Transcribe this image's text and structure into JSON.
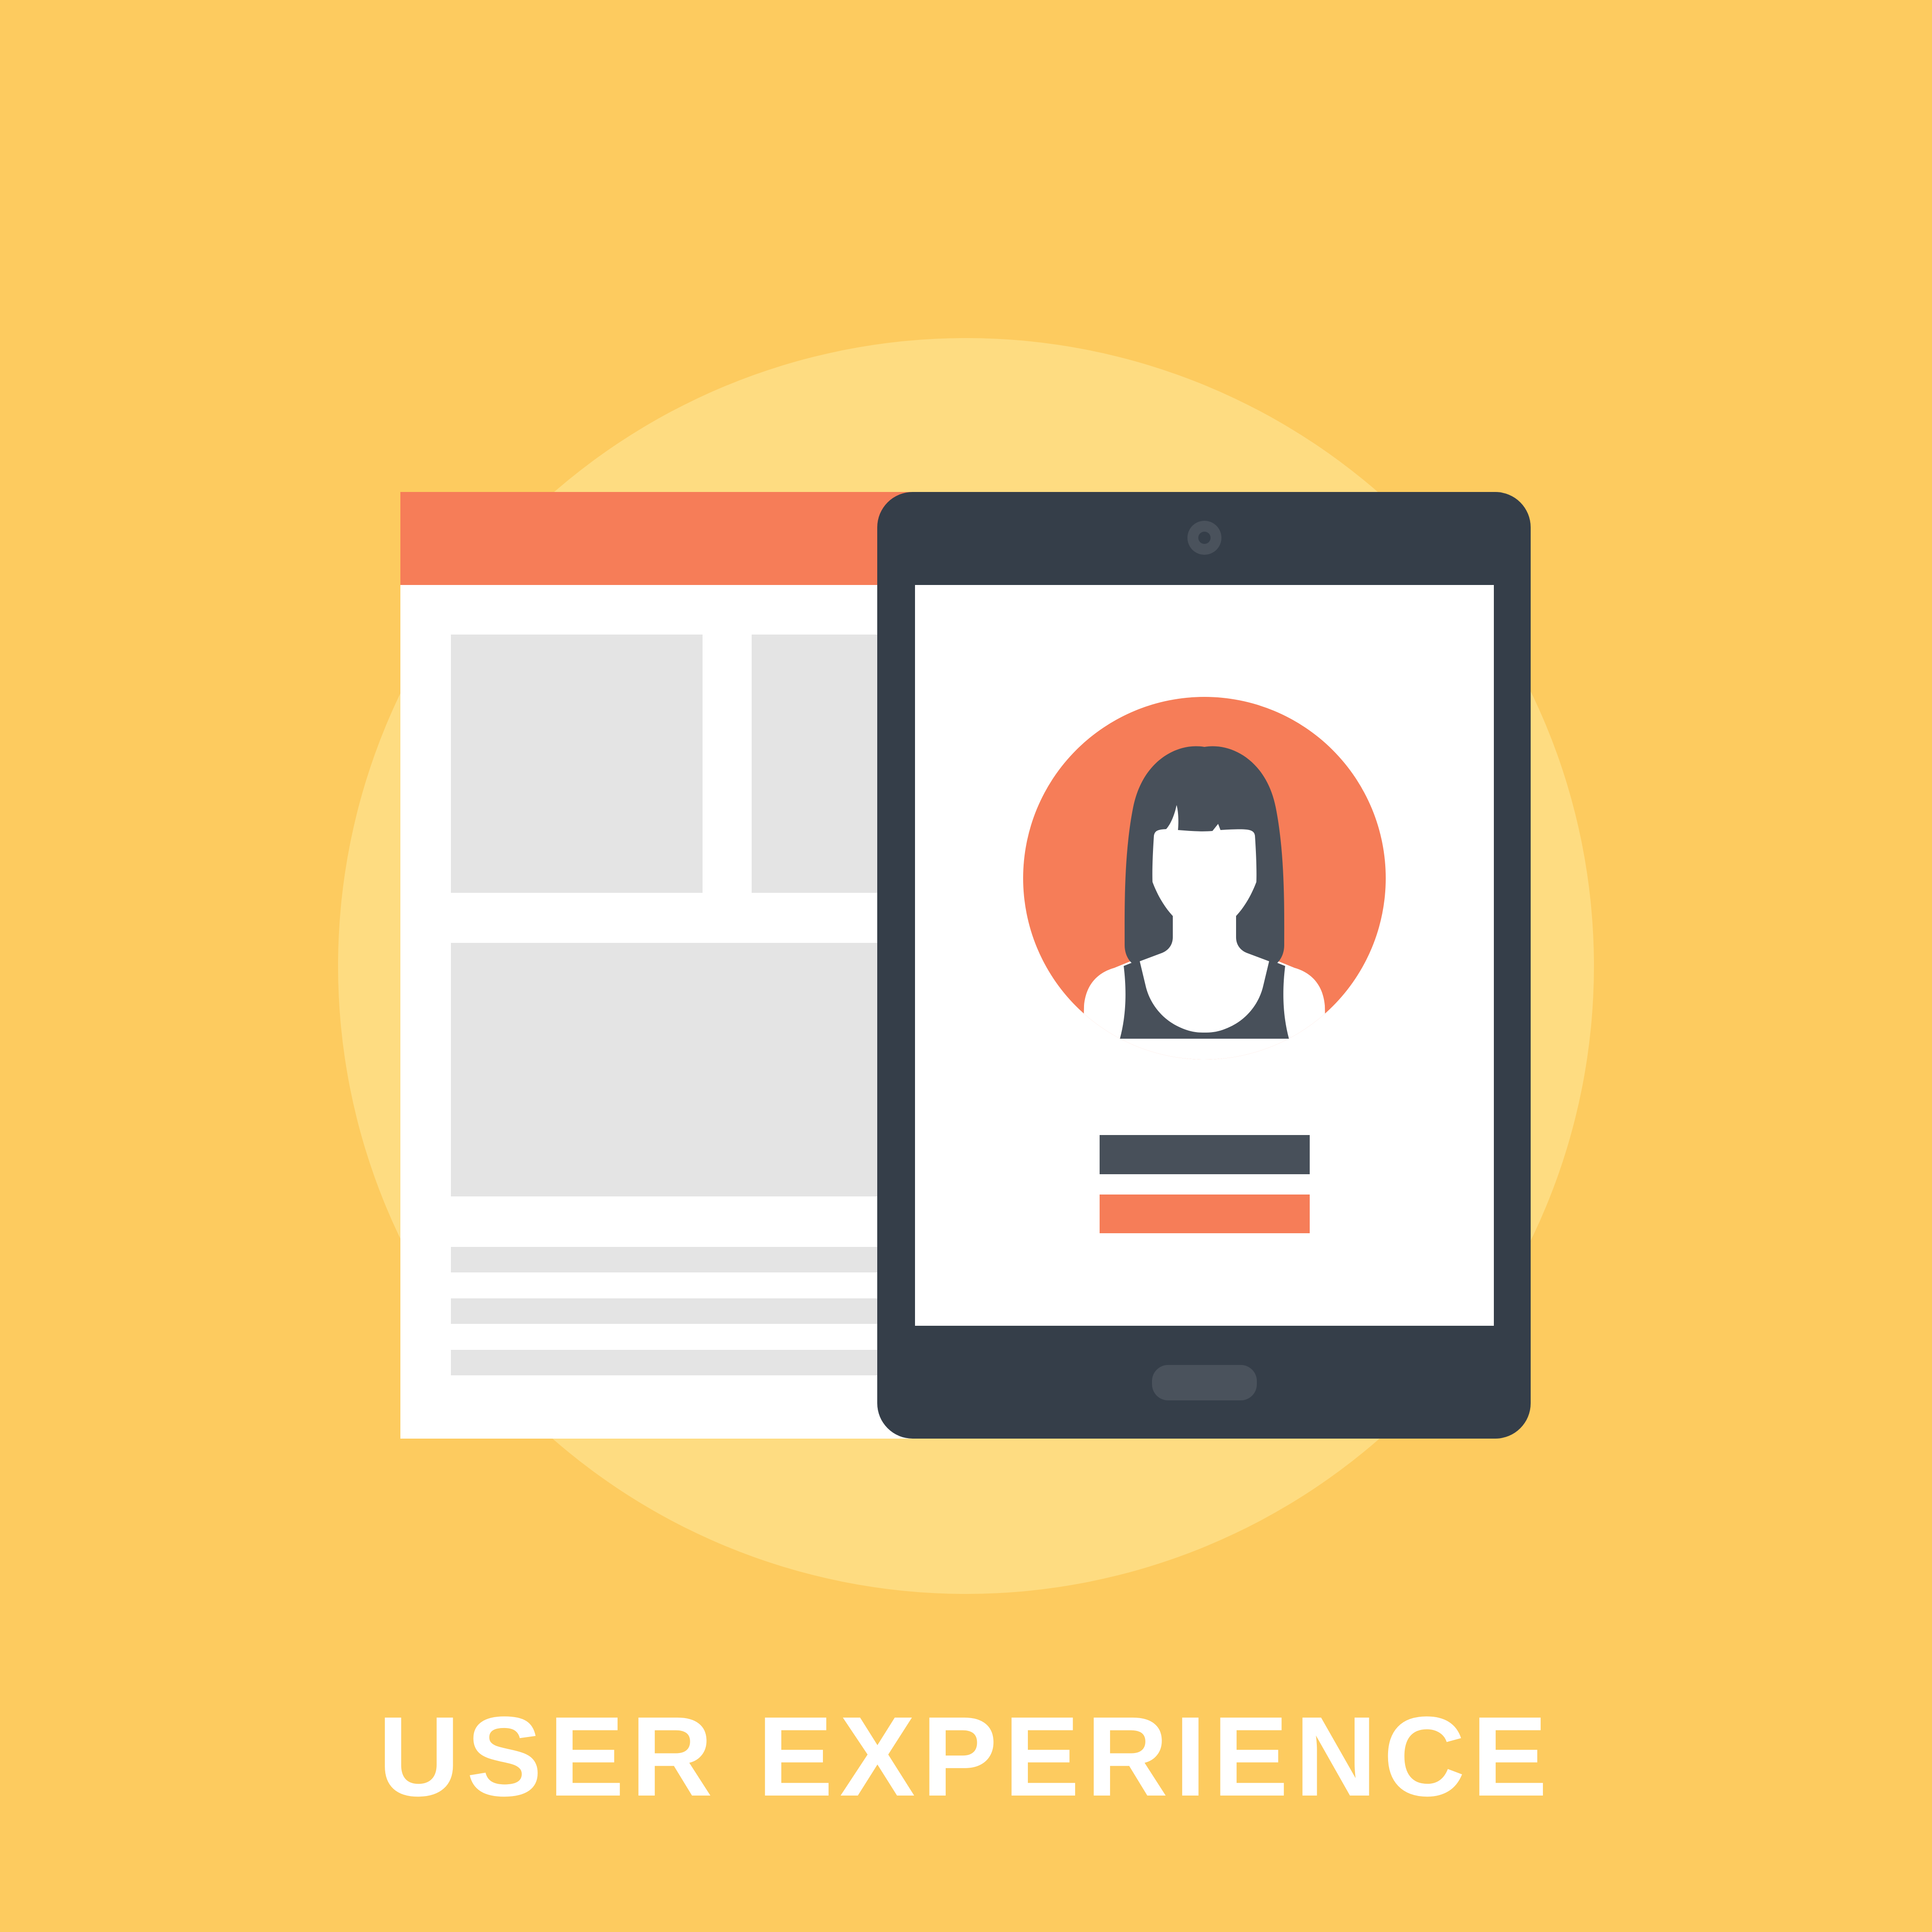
{
  "title": "USER EXPERIENCE",
  "colors": {
    "background": "#FDCB5F",
    "halo": "#FEDC81",
    "accent": "#F67D58",
    "device": "#353E49",
    "device_detail": "#4A525C",
    "panel": "#FFFFFF",
    "placeholder": "#E4E4E4",
    "hair": "#48505A",
    "caption": "#FFFFFF"
  },
  "illustration": {
    "window": "browser-window-wireframe",
    "device": "tablet",
    "avatar": "female-user-avatar-icon"
  }
}
